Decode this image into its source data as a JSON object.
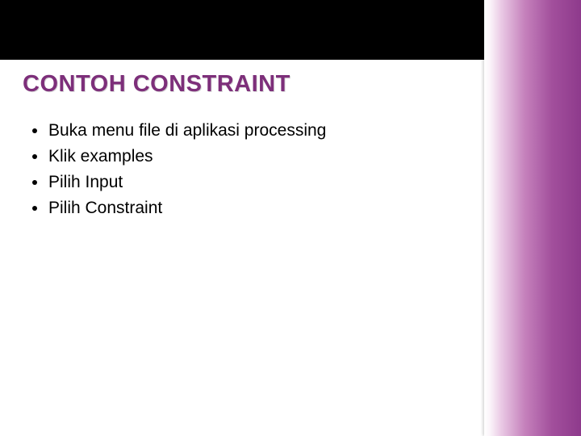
{
  "title": "CONTOH CONSTRAINT",
  "items": [
    "Buka menu file di aplikasi processing",
    "Klik examples",
    "Pilih Input",
    "Pilih Constraint"
  ]
}
